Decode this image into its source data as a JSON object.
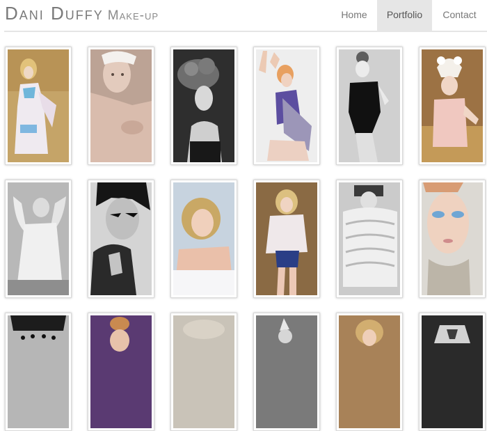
{
  "brand": {
    "name": "Dani Duffy",
    "subtitle": "Make-up"
  },
  "nav": {
    "items": [
      {
        "label": "Home"
      },
      {
        "label": "Portfolio",
        "active": true
      },
      {
        "label": "Contact"
      }
    ]
  },
  "colors": {
    "active_tab_bg": "#e6e6e6",
    "divider": "#e5e5e5",
    "text": "#777777"
  },
  "gallery": {
    "rows": [
      {
        "items": [
          {
            "subject": "blonde-woman-sheer-dress-hay"
          },
          {
            "subject": "woman-feathered-brows-sepia"
          },
          {
            "subject": "woman-flower-headdress-bw"
          },
          {
            "subject": "woman-arm-raised-purple-scarf"
          },
          {
            "subject": "woman-black-bodysuit-bw"
          },
          {
            "subject": "woman-ornate-headdress-hay"
          }
        ]
      },
      {
        "items": [
          {
            "subject": "angel-wings-bw"
          },
          {
            "subject": "dramatic-eyeliner-hands-bw"
          },
          {
            "subject": "curly-blonde-lying-on-bed"
          },
          {
            "subject": "curly-blonde-ruffled-blouse"
          },
          {
            "subject": "knitted-sweater-bw"
          },
          {
            "subject": "blue-eyeshadow-closeup"
          }
        ]
      },
      {
        "items": [
          {
            "subject": "face-dots-bw"
          },
          {
            "subject": "blonde-updo-colour"
          },
          {
            "subject": "pale-soft-portrait"
          },
          {
            "subject": "spiked-headpiece-bw"
          },
          {
            "subject": "curly-hair-colour"
          },
          {
            "subject": "geometric-mask-bw"
          }
        ]
      }
    ]
  }
}
